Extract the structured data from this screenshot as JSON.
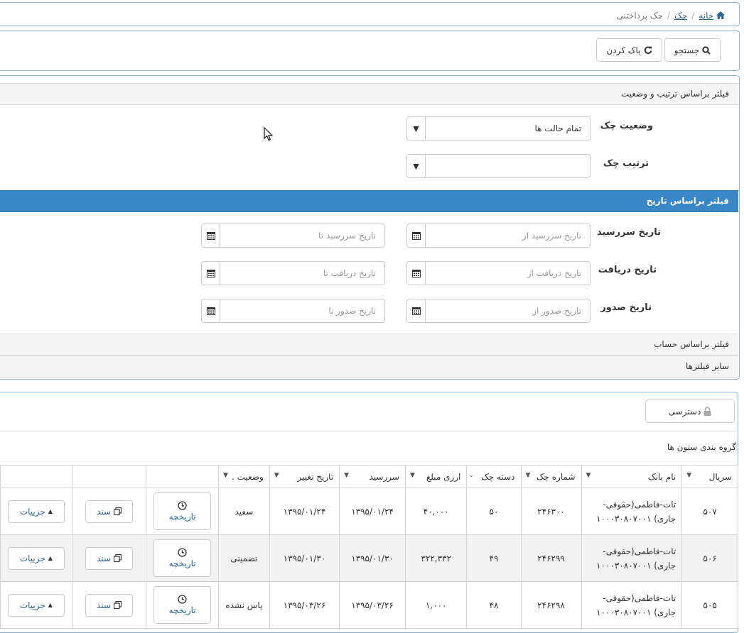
{
  "breadcrumb": {
    "home": "خانه",
    "check": "چک",
    "current": "چک پرداختنی"
  },
  "toolbar": {
    "search_label": "جستجو",
    "clear_label": "پاک کردن"
  },
  "filters": {
    "order_status_title": "فیلتر براساس ترتیب و وضعیت",
    "status_label": "وضعیت چک",
    "status_value": "تمام حالت ها",
    "order_label": "ترتیب چک",
    "order_value": "",
    "date_title": "فیلتر براساس تاریخ",
    "due_label": "تاریخ سررسید",
    "due_from_ph": "تاریخ سررسید از",
    "due_to_ph": "تاریخ سررسید تا",
    "receive_label": "تاریخ دریافت",
    "receive_from_ph": "تاریخ دریافت از",
    "receive_to_ph": "تاریخ دریافت تا",
    "issue_label": "تاریخ صدور",
    "issue_from_ph": "تاریخ صدور از",
    "issue_to_ph": "تاریخ صدور تا",
    "account_title": "فیلتر براساس حساب",
    "other_title": "سایر فیلترها"
  },
  "access_label": "دسترسی",
  "grouping_label": "گروه بندی ستون ها",
  "columns": [
    "سریال",
    "نام بانک",
    "شماره چک",
    "دسته چک",
    "ارزی مبلغ",
    "سررسید",
    "تاریخ تغییر",
    "وضعیت .",
    "",
    "",
    ""
  ],
  "row_buttons": {
    "history": "تاریخچه",
    "document": "سند",
    "details": "جزییات"
  },
  "rows": [
    {
      "serial": "۵۰۷",
      "bank1": "تات-فاطمی(حقوقی-",
      "bank2": "جاری) ۱۰۰۰۳۰۸۰۷۰۰۱",
      "check_no": "۲۴۶۳۰۰",
      "book": "۵۰",
      "amount": "۴۰,۰۰۰",
      "due": "۱۳۹۵/۰۱/۲۴",
      "changed": "۱۳۹۵/۰۱/۲۴",
      "status": "سفید"
    },
    {
      "serial": "۵۰۶",
      "bank1": "تات-فاطمی(حقوقی-",
      "bank2": "جاری) ۱۰۰۰۳۰۸۰۷۰۰۱",
      "check_no": "۲۴۶۲۹۹",
      "book": "۴۹",
      "amount": "۳۲۲,۳۳۲",
      "due": "۱۳۹۵/۰۱/۳۰",
      "changed": "۱۳۹۵/۰۱/۳۰",
      "status": "تضمینی"
    },
    {
      "serial": "۵۰۵",
      "bank1": "تات-فاطمی(حقوقی-",
      "bank2": "جاری) ۱۰۰۰۳۰۸۰۷۰۰۱",
      "check_no": "۲۴۶۲۹۸",
      "book": "۴۸",
      "amount": "۱,۰۰۰",
      "due": "۱۳۹۵/۰۳/۲۶",
      "changed": "۱۳۹۵/۰۳/۲۶",
      "status": "پاس نشده"
    }
  ]
}
